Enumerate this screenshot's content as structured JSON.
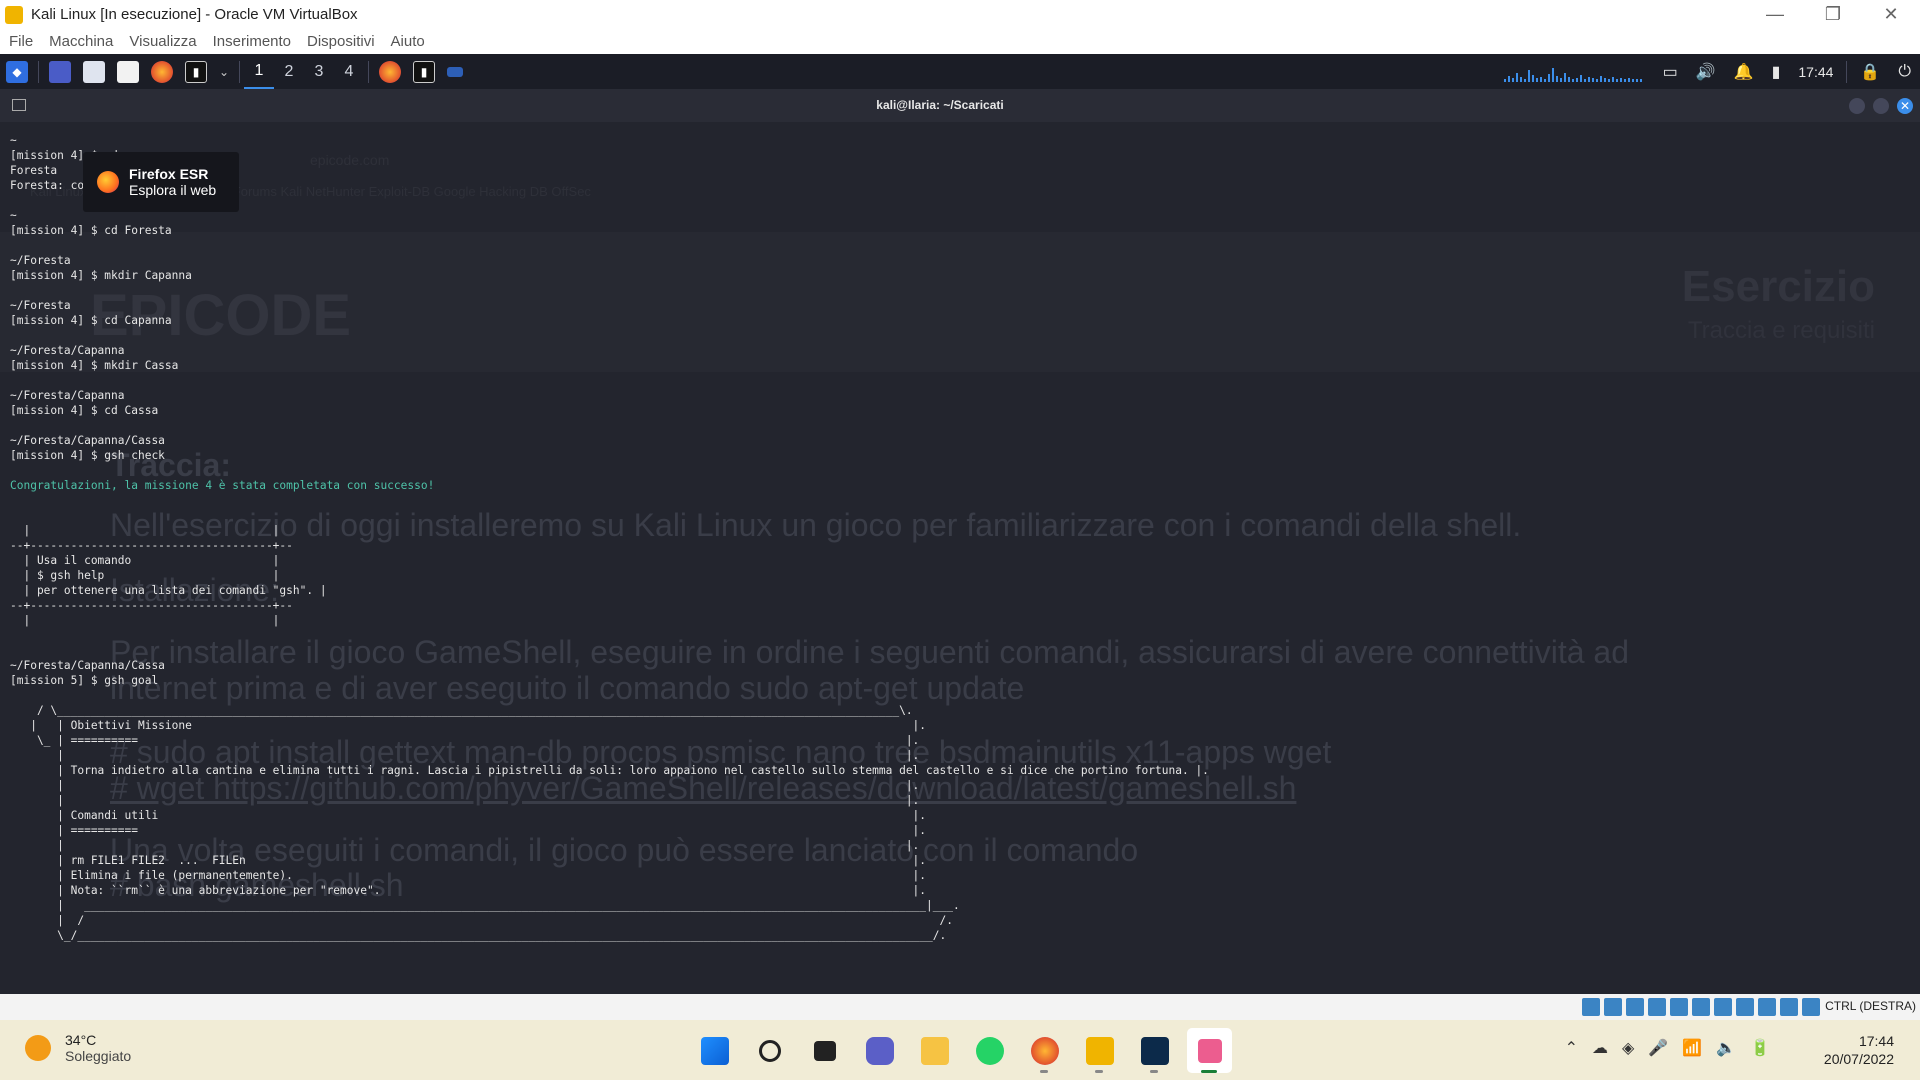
{
  "vbox": {
    "title": "Kali Linux [In esecuzione] - Oracle VM VirtualBox",
    "menu": [
      "File",
      "Macchina",
      "Visualizza",
      "Inserimento",
      "Dispositivi",
      "Aiuto"
    ],
    "host_key": "CTRL (DESTRA)"
  },
  "kali_panel": {
    "workspaces": [
      "1",
      "2",
      "3",
      "4"
    ],
    "active_workspace": "1",
    "clock": "17:44"
  },
  "terminal": {
    "title": "kali@Ilaria: ~/Scaricati",
    "lines": [
      "~",
      "[mission 4] $ cd ~",
      "Foresta",
      "Foresta: command not found",
      "",
      "~",
      "[mission 4] $ cd Foresta",
      "",
      "~/Foresta",
      "[mission 4] $ mkdir Capanna",
      "",
      "~/Foresta",
      "[mission 4] $ cd Capanna",
      "",
      "~/Foresta/Capanna",
      "[mission 4] $ mkdir Cassa",
      "",
      "~/Foresta/Capanna",
      "[mission 4] $ cd Cassa",
      "",
      "~/Foresta/Capanna/Cassa",
      "[mission 4] $ gsh check",
      "",
      "Congratulazioni, la missione 4 è stata completata con successo!",
      "",
      "",
      "  |                                    |",
      "--+------------------------------------+--",
      "  | Usa il comando                     |",
      "  | $ gsh help                         |",
      "  | per ottenere una lista dei comandi \"gsh\". |",
      "--+------------------------------------+--",
      "  |                                    |",
      "",
      "",
      "~/Foresta/Capanna/Cassa",
      "[mission 5] $ gsh goal",
      "",
      "    / \\_____________________________________________________________________________________________________________________________\\.",
      "   |   | Obiettivi Missione                                                                                                           |.",
      "    \\_ | ==========                                                                                                                  |.",
      "       |                                                                                                                             |.",
      "       | Torna indietro alla cantina e elimina tutti i ragni. Lascia i pipistrelli da soli: loro appaiono nel castello sullo stemma del castello e si dice che portino fortuna. |.",
      "       |                                                                                                                             |.",
      "       |                                                                                                                             |.",
      "       | Comandi utili                                                                                                                |.",
      "       | ==========                                                                                                                   |.",
      "       |                                                                                                                             |.",
      "       | rm FILE1 FILE2  ...  FILEn                                                                                                   |.",
      "       | Elimina i file (permanentemente).                                                                                            |.",
      "       | Nota: ``rm`` è una abbreviazione per \"remove\".                                                                               |.",
      "       |   _____________________________________________________________________________________________________________________________|___.",
      "       |  /                                                                                                                               /.",
      "       \\_/_______________________________________________________________________________________________________________________________/."
    ],
    "success_line_index": 23
  },
  "tooltip": {
    "title": "Firefox ESR",
    "subtitle": "Esplora il web"
  },
  "ghost_page": {
    "address": "epicode.com",
    "bookmarks": "Kali Linux   Kali Tools   Kali Docs   Kali Forums   Kali NetHunter   Exploit-DB   Google Hacking DB   OffSec",
    "logo": "EPICODE",
    "exercise_title": "Esercizio",
    "exercise_subtitle": "Traccia e requisiti",
    "lines": [
      "Traccia:",
      "Nell'esercizio di oggi installeremo su Kali Linux un gioco per familiarizzare con i comandi della shell.",
      "Istallazione:",
      "Per installare il gioco GameShell, eseguire in ordine i seguenti comandi, assicurarsi di avere connettività ad",
      "internet prima e di aver eseguito il comando sudo apt-get update",
      "# sudo apt install gettext man-db procps psmisc nano tree bsdmainutils x11-apps wget",
      "# wget https://github.com/phyver/GameShell/releases/download/latest/gameshell.sh",
      "Una volta eseguiti i comandi, il gioco può essere lanciato con il comando",
      "# bash gameshell.sh"
    ]
  },
  "taskbar": {
    "weather_temp": "34°C",
    "weather_desc": "Soleggiato",
    "time": "17:44",
    "date": "20/07/2022"
  }
}
